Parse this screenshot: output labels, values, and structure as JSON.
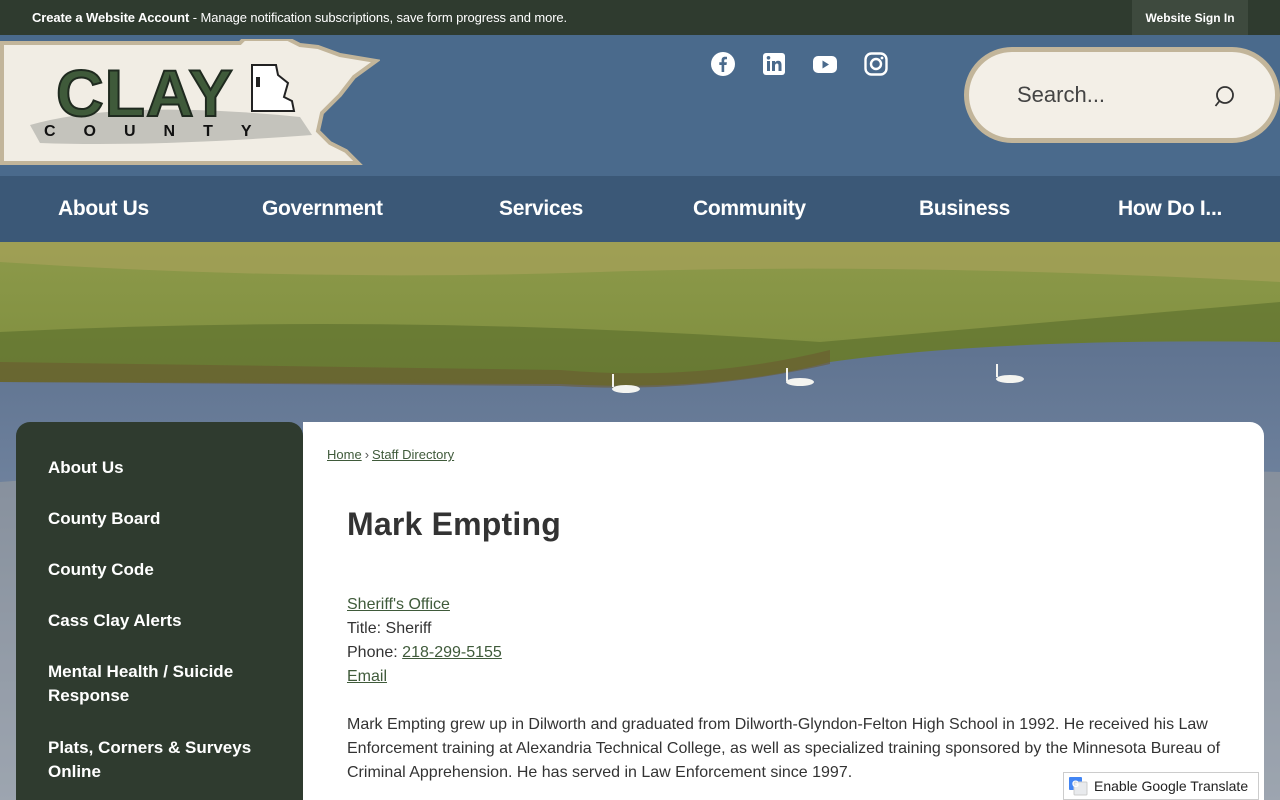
{
  "topbar": {
    "account_link": "Create a Website Account",
    "account_desc": " - Manage notification subscriptions, save form progress and more.",
    "signin_label": "Website Sign In"
  },
  "header": {
    "logo_text_main": "CLAY",
    "logo_text_sub": "C O U N T Y",
    "social_icons": [
      "facebook-icon",
      "linkedin-icon",
      "youtube-icon",
      "instagram-icon"
    ],
    "search_placeholder": "Search..."
  },
  "nav": {
    "items": [
      "About Us",
      "Government",
      "Services",
      "Community",
      "Business",
      "How Do I..."
    ]
  },
  "sidebar": {
    "items": [
      "About Us",
      "County Board",
      "County Code",
      "Cass Clay Alerts",
      "Mental Health / Suicide Response",
      "Plats, Corners & Surveys Online"
    ]
  },
  "breadcrumb": {
    "home": "Home",
    "separator": "›",
    "current": "Staff Directory"
  },
  "profile": {
    "name": "Mark Empting",
    "department": "Sheriff's Office",
    "title_label": "Title:",
    "title_value": "Sheriff",
    "phone_label": "Phone:",
    "phone_value": "218-299-5155",
    "email_label": "Email",
    "bio": "Mark Empting grew up in Dilworth and graduated from Dilworth-Glyndon-Felton High School in 1992.  He received his Law Enforcement training at Alexandria Technical College, as well as specialized training sponsored by the Minnesota Bureau of Criminal Apprehension.  He has served in Law Enforcement since 1997."
  },
  "translate": {
    "label": "Enable Google Translate"
  },
  "colors": {
    "topbar": "#2f3b2f",
    "header": "#4a6a8c",
    "nav": "#3b5877",
    "sidebar": "#2f3b2f",
    "link": "#3f5a3a",
    "search_border": "#c2b59a"
  }
}
